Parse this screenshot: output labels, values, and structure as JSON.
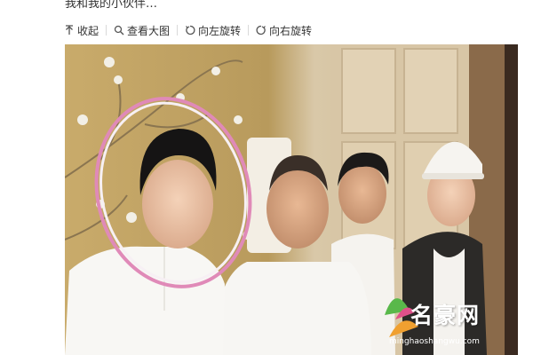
{
  "post": {
    "caption": "我和我的小伙伴…"
  },
  "toolbar": {
    "items": [
      {
        "label": "收起",
        "icon": "collapse-up-icon"
      },
      {
        "label": "查看大图",
        "icon": "magnifier-icon"
      },
      {
        "label": "向左旋转",
        "icon": "rotate-left-icon"
      },
      {
        "label": "向右旋转",
        "icon": "rotate-right-icon"
      }
    ]
  },
  "watermark": {
    "logo_text": "名豪网",
    "url_text": "minghaoshangwu.com"
  },
  "colors": {
    "circle_highlight": "#e08ab8",
    "wall": "#c8a96a"
  }
}
